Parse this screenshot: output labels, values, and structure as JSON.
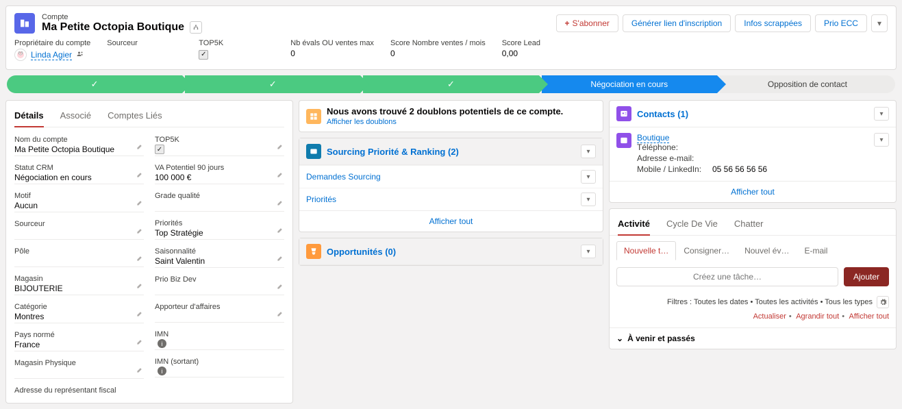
{
  "header": {
    "breadcrumb": "Compte",
    "title": "Ma Petite Octopia Boutique",
    "actions": {
      "follow": "S'abonner",
      "genLink": "Générer lien d'inscription",
      "infos": "Infos scrappées",
      "prio": "Prio ECC"
    }
  },
  "highlights": {
    "owner_label": "Propriétaire du compte",
    "owner_value": "Linda Agier",
    "sourceur_label": "Sourceur",
    "sourceur_value": "",
    "top5k_label": "TOP5K",
    "top5k_checked": true,
    "nbevals_label": "Nb évals OU ventes max",
    "nbevals_value": "0",
    "scoreventes_label": "Score Nombre ventes / mois",
    "scoreventes_value": "0",
    "scorelead_label": "Score Lead",
    "scorelead_value": "0,00"
  },
  "path": {
    "current": "Négociation en cours",
    "future": "Opposition de contact"
  },
  "tabs": {
    "details": "Détails",
    "associe": "Associé",
    "comptes_lies": "Comptes Liés"
  },
  "details": {
    "nom_compte_l": "Nom du compte",
    "nom_compte_v": "Ma Petite Octopia Boutique",
    "statut_l": "Statut CRM",
    "statut_v": "Négociation en cours",
    "motif_l": "Motif",
    "motif_v": "Aucun",
    "sourceur_l": "Sourceur",
    "sourceur_v": "",
    "pole_l": "Pôle",
    "pole_v": "",
    "magasin_l": "Magasin",
    "magasin_v": "BIJOUTERIE",
    "categorie_l": "Catégorie",
    "categorie_v": "Montres",
    "pays_l": "Pays normé",
    "pays_v": "France",
    "magphys_l": "Magasin Physique",
    "magphys_v": "",
    "adresse_l": "Adresse du représentant fiscal",
    "top5k_l": "TOP5K",
    "va_l": "VA Potentiel 90 jours",
    "va_v": "100 000 €",
    "grade_l": "Grade qualité",
    "grade_v": "",
    "priorites_l": "Priorités",
    "priorites_v": "Top Stratégie",
    "saison_l": "Saisonnalité",
    "saison_v": "Saint Valentin",
    "priobiz_l": "Prio Biz Dev",
    "priobiz_v": "",
    "apporteur_l": "Apporteur d'affaires",
    "apporteur_v": "",
    "imn_l": "IMN",
    "imn_v": "",
    "imn_sort_l": "IMN (sortant)",
    "imn_sort_v": ""
  },
  "duplicates": {
    "title": "Nous avons trouvé 2 doublons potentiels de ce compte.",
    "link": "Afficher les doublons"
  },
  "sourcing": {
    "title": "Sourcing Priorité & Ranking (2)",
    "item1": "Demandes Sourcing",
    "item2": "Priorités",
    "afficher": "Afficher tout"
  },
  "opportunites": {
    "title": "Opportunités (0)"
  },
  "contacts": {
    "title": "Contacts (1)",
    "name": "Boutique",
    "tel_l": "Téléphone:",
    "tel_v": "",
    "email_l": "Adresse e-mail:",
    "email_v": "",
    "mobile_l": "Mobile / LinkedIn:",
    "mobile_v": "05 56 56 56 56",
    "afficher": "Afficher tout"
  },
  "activity": {
    "tab1": "Activité",
    "tab2": "Cycle De Vie",
    "tab3": "Chatter",
    "sub1": "Nouvelle t…",
    "sub2": "Consigner…",
    "sub3": "Nouvel év…",
    "sub4": "E-mail",
    "placeholder": "Créez une tâche…",
    "button": "Ajouter",
    "filters": "Filtres : Toutes les dates • Toutes les activités • Tous les types",
    "actualiser": "Actualiser",
    "agrandir": "Agrandir tout",
    "afficher": "Afficher tout",
    "timeline": "À venir et passés"
  }
}
